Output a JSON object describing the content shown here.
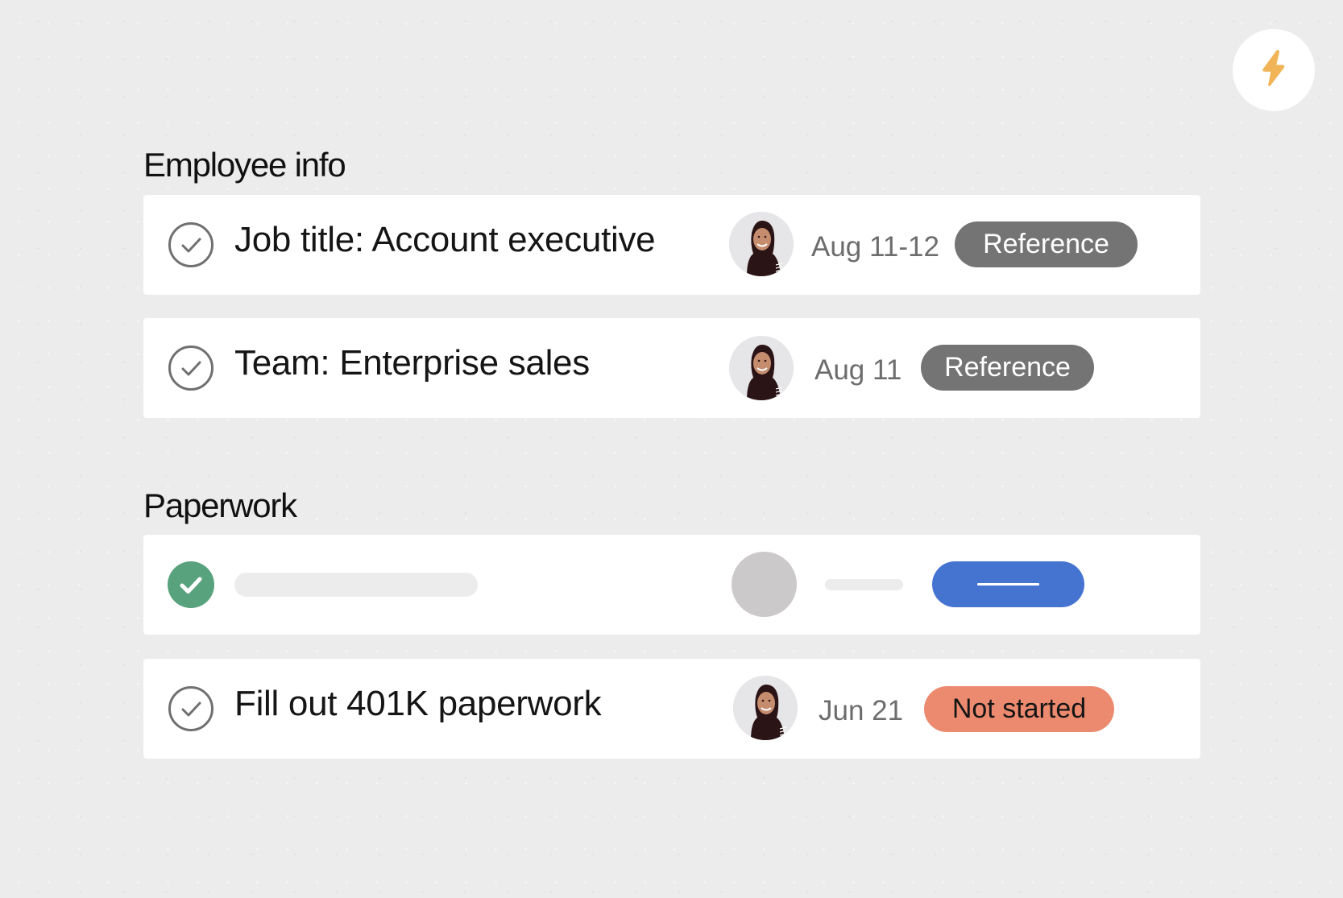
{
  "quick_action": {
    "icon": "lightning-bolt-icon",
    "icon_color": "#F1B457"
  },
  "sections": [
    {
      "heading": "Employee info",
      "tasks": [
        {
          "title": "Job title: Account executive",
          "completed": false,
          "assignee_avatar": "avatar-woman-hijab",
          "date": "Aug 11-12",
          "status": "Reference",
          "status_color": "#747474"
        },
        {
          "title": "Team: Enterprise sales",
          "completed": false,
          "assignee_avatar": "avatar-woman-hijab",
          "date": "Aug 11",
          "status": "Reference",
          "status_color": "#747474"
        }
      ]
    },
    {
      "heading": "Paperwork",
      "tasks": [
        {
          "placeholder": true,
          "completed": true,
          "check_color": "#58A27E",
          "status_color": "#4573D0"
        },
        {
          "title": "Fill out 401K paperwork",
          "completed": false,
          "assignee_avatar": "avatar-woman-hijab",
          "date": "Jun 21",
          "status": "Not started",
          "status_color": "#EC8A6F"
        }
      ]
    }
  ]
}
